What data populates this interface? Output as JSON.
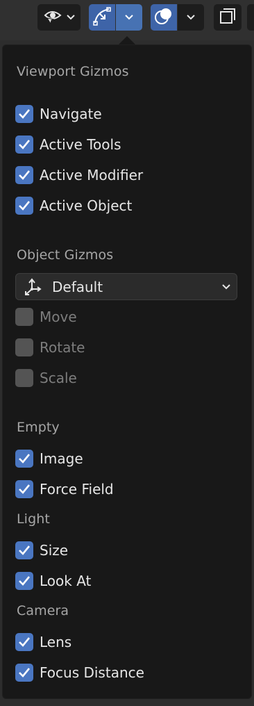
{
  "toolbar": {
    "items": [
      {
        "icon": "visibility-eye-icon",
        "has_dropdown": true,
        "active": false
      },
      {
        "icon": "gizmo-curve-icon",
        "has_dropdown": true,
        "active": true
      },
      {
        "icon": "overlay-circles-icon",
        "has_dropdown": true,
        "active": true
      },
      {
        "icon": "xray-toggle-icon",
        "has_dropdown": false,
        "active": false
      }
    ]
  },
  "popover": {
    "viewport_gizmos": {
      "heading": "Viewport Gizmos",
      "items": [
        {
          "label": "Navigate",
          "checked": true
        },
        {
          "label": "Active Tools",
          "checked": true
        },
        {
          "label": "Active Modifier",
          "checked": true
        },
        {
          "label": "Active Object",
          "checked": true
        }
      ]
    },
    "object_gizmos": {
      "heading": "Object Gizmos",
      "dropdown": {
        "value": "Default",
        "icon": "transform-orientation-icon"
      },
      "items": [
        {
          "label": "Move",
          "checked": false
        },
        {
          "label": "Rotate",
          "checked": false
        },
        {
          "label": "Scale",
          "checked": false
        }
      ]
    },
    "empty": {
      "heading": "Empty",
      "items": [
        {
          "label": "Image",
          "checked": true
        },
        {
          "label": "Force Field",
          "checked": true
        }
      ]
    },
    "light": {
      "heading": "Light",
      "items": [
        {
          "label": "Size",
          "checked": true
        },
        {
          "label": "Look At",
          "checked": true
        }
      ]
    },
    "camera": {
      "heading": "Camera",
      "items": [
        {
          "label": "Lens",
          "checked": true
        },
        {
          "label": "Focus Distance",
          "checked": true
        }
      ]
    }
  },
  "colors": {
    "accent": "#4a76c1",
    "popover_bg": "#181818",
    "heading_text": "#a6a6a6",
    "unchecked_box": "#545454"
  }
}
